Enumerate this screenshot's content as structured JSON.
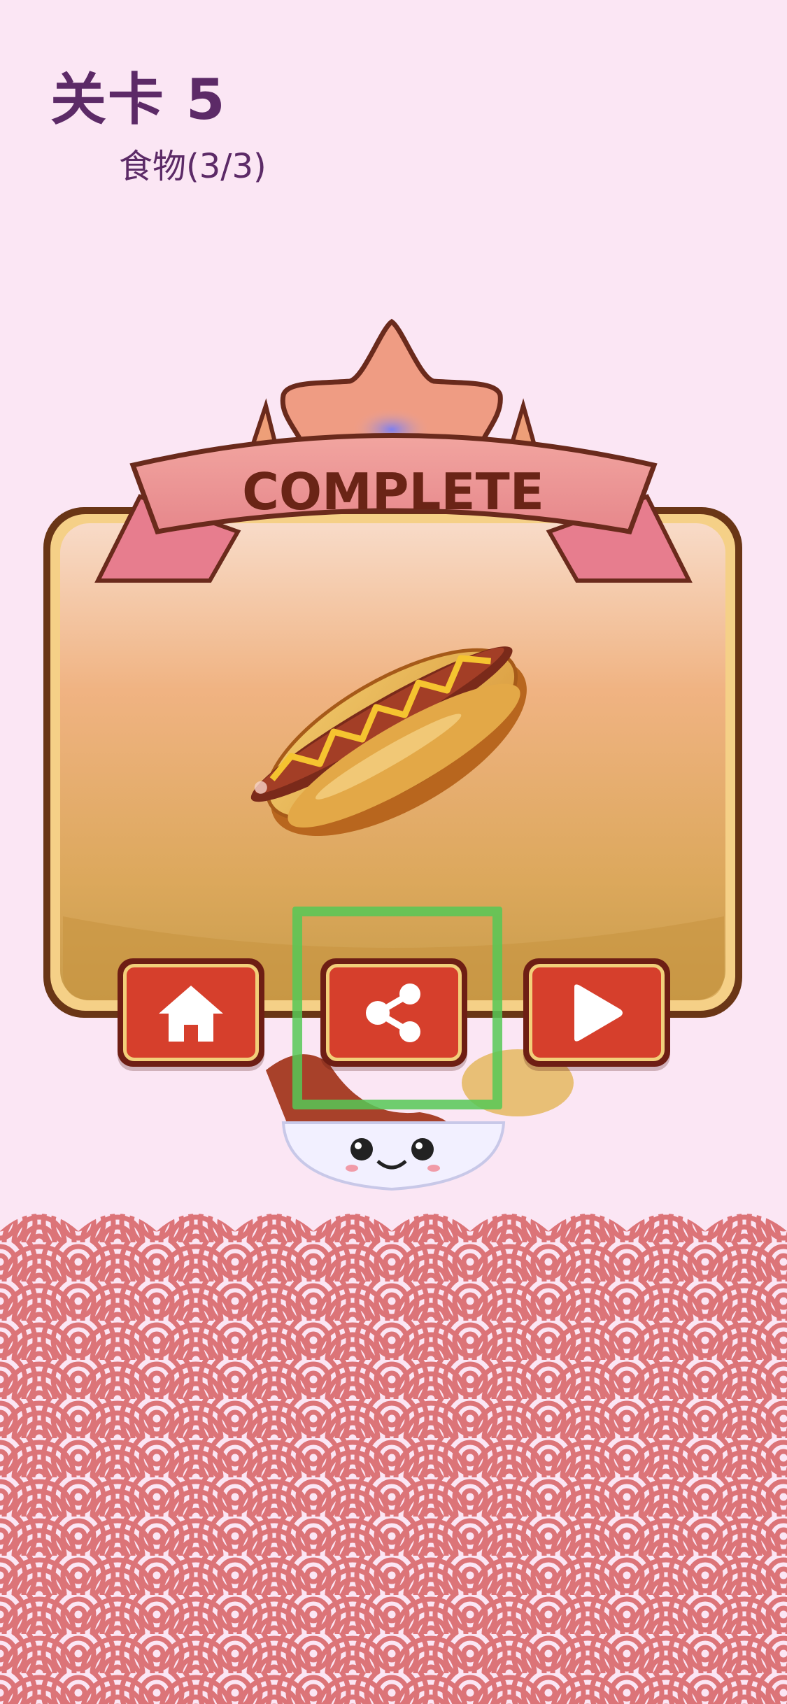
{
  "level": {
    "title": "关卡 5"
  },
  "progress": {
    "label": "食物(3/3)"
  },
  "dialog": {
    "banner_text": "COMPLETE",
    "reward_item": "hotdog-illustration"
  },
  "buttons": {
    "home": {
      "icon": "home-icon"
    },
    "share": {
      "icon": "share-icon"
    },
    "next": {
      "icon": "play-icon"
    }
  },
  "colors": {
    "background": "#fbe6f4",
    "title_text": "#5c2a67",
    "button_face": "#d63f2c",
    "button_border": "#f2cf7a",
    "ribbon": "#e88a8f",
    "wave_pattern": "#dc7478",
    "highlight": "#56c856"
  }
}
